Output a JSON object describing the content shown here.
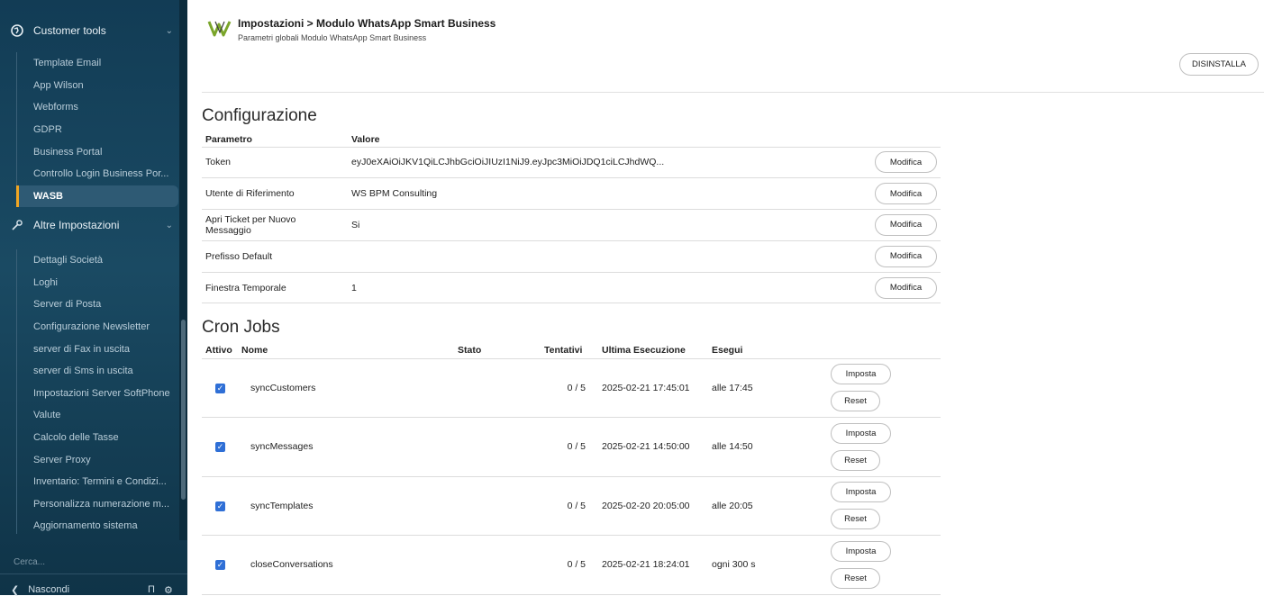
{
  "sidebar": {
    "section1": {
      "title": "Customer tools",
      "icon": "globe-icon"
    },
    "items1": [
      {
        "label": "Template Email"
      },
      {
        "label": "App Wilson"
      },
      {
        "label": "Webforms"
      },
      {
        "label": "GDPR"
      },
      {
        "label": "Business Portal"
      },
      {
        "label": "Controllo Login Business Por..."
      },
      {
        "label": "WASB",
        "active": true
      }
    ],
    "section2": {
      "title": "Altre Impostazioni",
      "icon": "wrench-icon"
    },
    "items2": [
      {
        "label": "Dettagli Società"
      },
      {
        "label": "Loghi"
      },
      {
        "label": "Server di Posta"
      },
      {
        "label": "Configurazione Newsletter"
      },
      {
        "label": "server di Fax in uscita"
      },
      {
        "label": "server di Sms in uscita"
      },
      {
        "label": "Impostazioni Server SoftPhone"
      },
      {
        "label": "Valute"
      },
      {
        "label": "Calcolo delle Tasse"
      },
      {
        "label": "Server Proxy"
      },
      {
        "label": "Inventario: Termini e Condizi..."
      },
      {
        "label": "Personalizza numerazione m..."
      },
      {
        "label": "Aggiornamento sistema"
      }
    ],
    "search_placeholder": "Cerca...",
    "footer_label": "Nascondi"
  },
  "header": {
    "logo_text": "WA",
    "title": "Impostazioni > Modulo WhatsApp Smart Business",
    "subtitle": "Parametri globali Modulo WhatsApp Smart Business",
    "uninstall_label": "DISINSTALLA"
  },
  "config": {
    "title": "Configurazione",
    "col_param": "Parametro",
    "col_value": "Valore",
    "edit_label": "Modifica",
    "rows": [
      {
        "param": "Token",
        "value": "eyJ0eXAiOiJKV1QiLCJhbGciOiJIUzI1NiJ9.eyJpc3MiOiJDQ1ciLCJhdWQ..."
      },
      {
        "param": "Utente di Riferimento",
        "value": "WS BPM Consulting"
      },
      {
        "param": "Apri Ticket per Nuovo Messaggio",
        "value": "Si"
      },
      {
        "param": "Prefisso Default",
        "value": ""
      },
      {
        "param": "Finestra Temporale",
        "value": "1"
      }
    ]
  },
  "cron": {
    "title": "Cron Jobs",
    "cols": {
      "active": "Attivo",
      "name": "Nome",
      "status": "Stato",
      "attempts": "Tentativi",
      "last_run": "Ultima Esecuzione",
      "run": "Esegui"
    },
    "set_label": "Imposta",
    "reset_label": "Reset",
    "rows": [
      {
        "active": true,
        "name": "syncCustomers",
        "status": "",
        "attempts": "0 / 5",
        "last_run": "2025-02-21 17:45:01",
        "run": "alle 17:45"
      },
      {
        "active": true,
        "name": "syncMessages",
        "status": "",
        "attempts": "0 / 5",
        "last_run": "2025-02-21 14:50:00",
        "run": "alle 14:50"
      },
      {
        "active": true,
        "name": "syncTemplates",
        "status": "",
        "attempts": "0 / 5",
        "last_run": "2025-02-20 20:05:00",
        "run": "alle 20:05"
      },
      {
        "active": true,
        "name": "closeConversations",
        "status": "",
        "attempts": "0 / 5",
        "last_run": "2025-02-21 18:24:01",
        "run": "ogni 300 s"
      }
    ]
  },
  "colors": {
    "sidebar_bg": "#123c55",
    "active_accent": "#f0a623",
    "checkbox": "#2f6fd6"
  }
}
